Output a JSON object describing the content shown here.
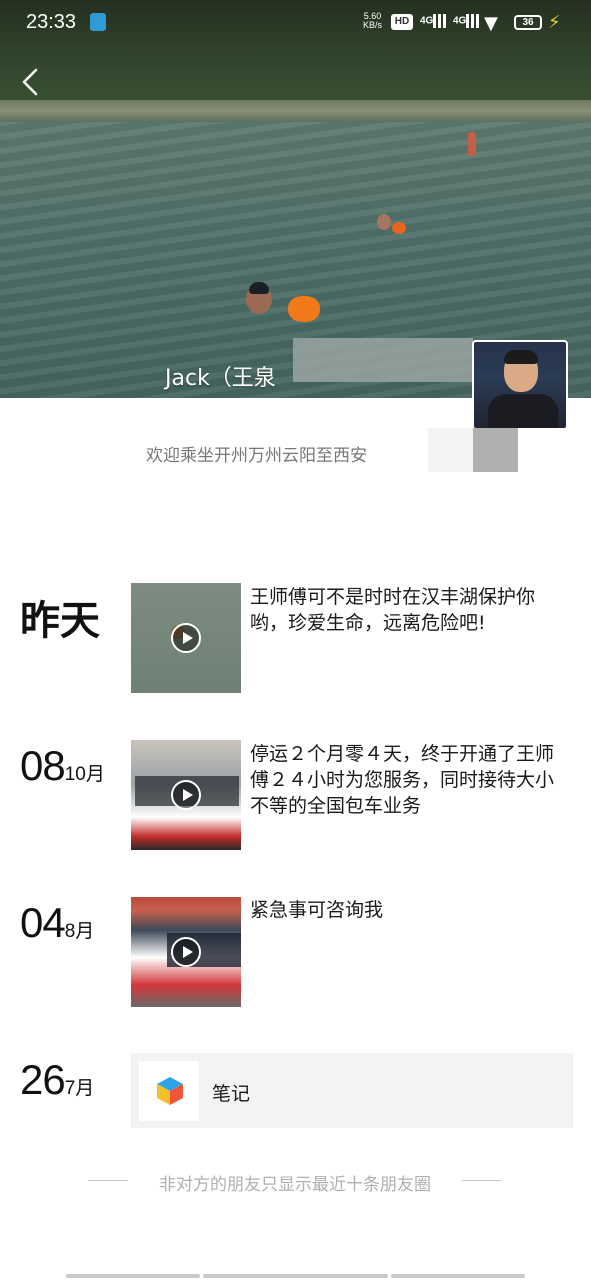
{
  "status_bar": {
    "time": "23:33",
    "net_speed_value": "5.60",
    "net_speed_unit": "KB/s",
    "hd_label": "HD",
    "signal1_label": "4G",
    "signal2_label": "4G",
    "battery": "36"
  },
  "profile": {
    "nickname": "Jack（王泉",
    "signature": "欢迎乘坐开州万州云阳至西安"
  },
  "feed": [
    {
      "day_text": "昨天",
      "text": "王师傅可不是时时在汉丰湖保护你哟，珍爱生命，远离危险吧!"
    },
    {
      "day": "08",
      "month": "10月",
      "text": "停运２个月零４天，终于开通了王师傅２４小时为您服务，同时接待大小不等的全国包车业务"
    },
    {
      "day": "04",
      "month": "8月",
      "text": "紧急事可咨询我"
    },
    {
      "day": "26",
      "month": "7月",
      "note_label": "笔记"
    }
  ],
  "footer_tip": "非对方的朋友只显示最近十条朋友圈",
  "colors": {
    "accent_orange": "#f07a1a",
    "battery_green": "#7cd24a",
    "muted_text": "#b0b0b0"
  },
  "icons": {
    "back": "chevron-left-icon",
    "play": "play-icon",
    "note": "cube-icon"
  }
}
